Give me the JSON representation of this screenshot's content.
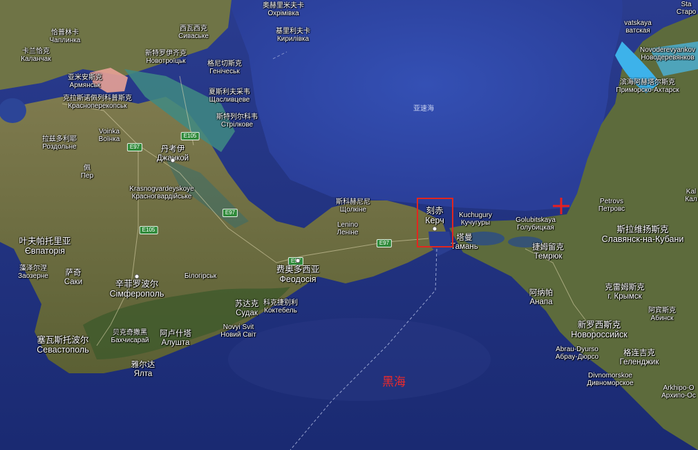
{
  "map": {
    "seas": {
      "azov": "亚速海",
      "black": "黑海"
    },
    "roads": [
      "E97",
      "E105",
      "E97",
      "E105",
      "E97",
      "E97"
    ],
    "labels": [
      {
        "id": "khorly",
        "zh": "奥赫里米夫卡",
        "ru": "Охрімівка"
      },
      {
        "id": "kyrylivka",
        "zh": "基里利夫卡",
        "ru": "Кирилівка"
      },
      {
        "id": "chaplynka",
        "zh": "恰普林卡",
        "ru": "Чаплинка"
      },
      {
        "id": "syvaske",
        "zh": "西瓦西克",
        "ru": "Сиваське"
      },
      {
        "id": "kalanchak",
        "zh": "卡兰恰克",
        "ru": "Каланчак"
      },
      {
        "id": "novotroitske",
        "zh": "新特罗伊齐克",
        "ru": "Новотроїцьк"
      },
      {
        "id": "henichesk",
        "zh": "格尼切斯克",
        "ru": "Генічеськ"
      },
      {
        "id": "armiansk",
        "zh": "亚米安斯克",
        "ru": "Армянськ"
      },
      {
        "id": "shchaslyvtseve",
        "zh": "夏斯利夫采韦",
        "ru": "Щасливцеве"
      },
      {
        "id": "krasnoperekopsk",
        "zh": "克拉斯诺佩列科普斯克",
        "ru": "Красноперекопськ"
      },
      {
        "id": "strilkove",
        "zh": "斯特列尔科韦",
        "ru": "Стрілкове"
      },
      {
        "id": "voinka",
        "zh": "Voinka",
        "ru": "Воїнка"
      },
      {
        "id": "rozdolne",
        "zh": "拉兹多利耶",
        "ru": "Роздольне"
      },
      {
        "id": "dzhankoi",
        "zh": "丹考伊",
        "ru": "Джанкой"
      },
      {
        "id": "pervomaiske",
        "zh": "佩",
        "ru": "Пер"
      },
      {
        "id": "krasnogvardeyskoye",
        "zh": "Krasnogvardeyskoye",
        "ru": "Красногвардійське"
      },
      {
        "id": "shcholkine",
        "zh": "斯科赫尼尼",
        "ru": "Щолкіне"
      },
      {
        "id": "lenine",
        "zh": "Lenino",
        "ru": "Леніне"
      },
      {
        "id": "kerch",
        "zh": "刻赤",
        "ru": "Керч"
      },
      {
        "id": "kuchugury",
        "zh": "Kuchugury",
        "ru": "Кучугуры"
      },
      {
        "id": "taman",
        "zh": "塔曼",
        "ru": "Тамань"
      },
      {
        "id": "golubitskaya",
        "zh": "Golubitskaya",
        "ru": "Голубицкая"
      },
      {
        "id": "temryuk",
        "zh": "捷姆留克",
        "ru": "Темрюк"
      },
      {
        "id": "yevpatoria",
        "zh": "叶夫帕托里亚",
        "ru": "Євпаторія"
      },
      {
        "id": "zaozerne",
        "zh": "藻泽尔涅",
        "ru": "Заозерне"
      },
      {
        "id": "saky",
        "zh": "萨奇",
        "ru": "Саки"
      },
      {
        "id": "simferopol",
        "zh": "辛菲罗波尔",
        "ru": "Сімферополь"
      },
      {
        "id": "bilohirsk",
        "zh": "",
        "ru": "Білогірськ"
      },
      {
        "id": "feodosia",
        "zh": "费奥多西亚",
        "ru": "Феодосія"
      },
      {
        "id": "sudak",
        "zh": "苏达克",
        "ru": "Судак"
      },
      {
        "id": "koktebel",
        "zh": "科克捷别利",
        "ru": "Коктебель"
      },
      {
        "id": "novyisvit",
        "zh": "Novyi Svit",
        "ru": "Новий Світ"
      },
      {
        "id": "bakhchysarai",
        "zh": "贝克奇撒黑",
        "ru": "Бахчисарай"
      },
      {
        "id": "alushta",
        "zh": "阿卢什塔",
        "ru": "Алушта"
      },
      {
        "id": "sevastopol",
        "zh": "塞瓦斯托波尔",
        "ru": "Севастополь"
      },
      {
        "id": "yalta",
        "zh": "雅尔达",
        "ru": "Ялта"
      },
      {
        "id": "anapa",
        "zh": "阿纳帕",
        "ru": "Анапа"
      },
      {
        "id": "krymsk",
        "zh": "克雷姆斯克",
        "ru": "г. Крымск"
      },
      {
        "id": "abinsk",
        "zh": "阿宾斯克",
        "ru": "Абинск"
      },
      {
        "id": "novorossiysk",
        "zh": "新罗西斯克",
        "ru": "Новороссийск"
      },
      {
        "id": "abraudyurso",
        "zh": "Abrau-Dyurso",
        "ru": "Абрау-Дюрсо"
      },
      {
        "id": "gelendzhik",
        "zh": "格连吉克",
        "ru": "Геленджик"
      },
      {
        "id": "divnomorskoe",
        "zh": "Divnomorskoe",
        "ru": "Дивноморское"
      },
      {
        "id": "arkhipo",
        "zh": "Arkhipo-O",
        "ru": "Архипо-Ос"
      },
      {
        "id": "slavyansk",
        "zh": "斯拉维扬斯克",
        "ru": "Славянск-на-Кубани"
      },
      {
        "id": "petrovskaya",
        "zh": "Petrovs",
        "ru": "Петровс"
      },
      {
        "id": "primorsko",
        "zh": "滨海阿赫塔尔斯克",
        "ru": "Приморско-Ахтарск"
      },
      {
        "id": "novoderevyankovskaya",
        "zh": "Novoderevyankov",
        "ru": "Новодеревянков"
      },
      {
        "id": "starovelichkovskaya",
        "zh": "vatskaya",
        "ru": "ватская"
      },
      {
        "id": "staro",
        "zh": "Sta",
        "ru": "Старо"
      },
      {
        "id": "kalininskaya",
        "zh": "Kal",
        "ru": "Кал"
      }
    ],
    "accent_colors": {
      "highlight_box": "#e3261e",
      "cross_marker": "#e81f1f",
      "black_sea_label": "#ee2a2a"
    }
  }
}
